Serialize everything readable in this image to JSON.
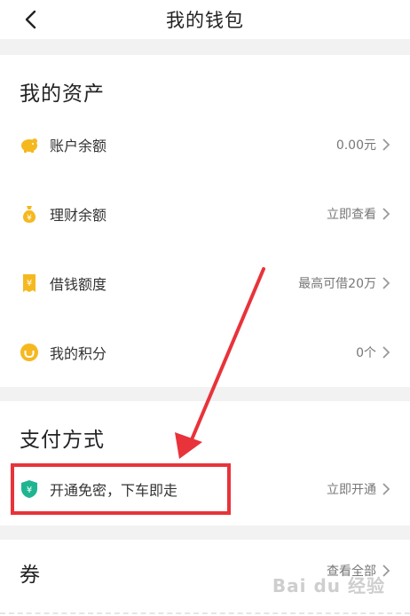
{
  "header": {
    "title": "我的钱包",
    "back_icon": "chevron-left-icon"
  },
  "assets": {
    "title": "我的资产",
    "items": [
      {
        "icon": "piggy-bank-icon",
        "label": "账户余额",
        "value": "0.00元"
      },
      {
        "icon": "money-bag-icon",
        "label": "理财余额",
        "value": "立即查看"
      },
      {
        "icon": "receipt-yen-icon",
        "label": "借钱额度",
        "value": "最高可借20万"
      },
      {
        "icon": "points-icon",
        "label": "我的积分",
        "value": "0个"
      }
    ]
  },
  "payment": {
    "title": "支付方式",
    "item": {
      "icon": "shield-yen-icon",
      "label": "开通免密，下车即走",
      "value": "立即开通"
    }
  },
  "coupons": {
    "title": "券",
    "value": "查看全部"
  },
  "watermark": "Bai du 经验",
  "colors": {
    "accent": "#f5b81f",
    "highlight": "#e8333a",
    "shield": "#1fb590"
  }
}
